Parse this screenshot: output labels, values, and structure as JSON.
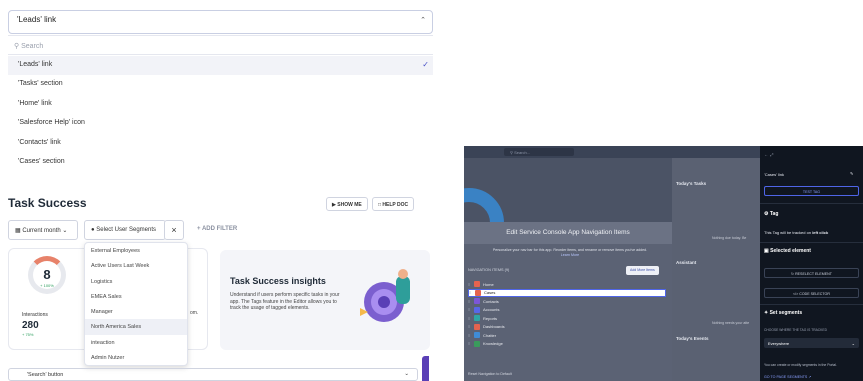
{
  "dropdown": {
    "selected_value": "'Leads' link",
    "search_placeholder": "Search",
    "options": [
      {
        "label": "'Leads' link",
        "selected": true
      },
      {
        "label": "'Tasks' section",
        "selected": false
      },
      {
        "label": "'Home' link",
        "selected": false
      },
      {
        "label": "'Salesforce Help' icon",
        "selected": false
      },
      {
        "label": "'Contacts' link",
        "selected": false
      },
      {
        "label": "'Cases' section",
        "selected": false
      }
    ]
  },
  "task_success": {
    "title": "Task Success",
    "show_me_label": "SHOW ME",
    "help_doc_label": "HELP DOC",
    "date_filter": "Current month",
    "segment_filter": "Select User Segments",
    "add_filter_label": "+ ADD FILTER",
    "gauge_value": "8",
    "gauge_change": "+ 100%",
    "interactions_label": "Interactions",
    "interactions_value": "280",
    "interactions_change": "+ 75%",
    "truncated_text": "om.",
    "insights_title": "Task Success insights",
    "insights_text": "Understand if users perform specific tasks in your app. The Tags feature in the Editor allows you to track the usage of tagged elements.",
    "segments_menu": [
      "External Employees",
      "Active Users Last Week",
      "Logistics",
      "EMEA Sales",
      "Manager",
      "North America Sales",
      "inteaction",
      "Admin Nutzer"
    ],
    "bottom_select": "'Search' button"
  },
  "salesforce": {
    "search_placeholder": "Search...",
    "todays_tasks": "Today's Tasks",
    "nothing_due": "Nothing due today. Be",
    "assistant": "Assistant",
    "nothing_needs": "Nothing needs your atte",
    "todays_events": "Today's Events",
    "modal_title": "Edit Service Console App Navigation Items",
    "modal_desc": "Personalize your nav bar for this app. Reorder items, and rename or remove items you've added.",
    "learn_more": "Learn More",
    "nav_items_label": "NAVIGATION ITEMS (9)",
    "add_more_label": "Add More Items",
    "nav_items": [
      {
        "label": "Home",
        "color": "#e5634f"
      },
      {
        "label": "Cases",
        "color": "#e5634f"
      },
      {
        "label": "Contacts",
        "color": "#7c56d8"
      },
      {
        "label": "Accounts",
        "color": "#5867e8"
      },
      {
        "label": "Reports",
        "color": "#2ea6a6"
      },
      {
        "label": "Dashboards",
        "color": "#e5634f"
      },
      {
        "label": "Chatter",
        "color": "#3f8cd6"
      },
      {
        "label": "Knowledge",
        "color": "#3a9b5c"
      }
    ],
    "reset_label": "Reset Navigation to Default"
  },
  "tag_panel": {
    "tag_name": "'Cases' link",
    "test_tag_label": "TEST TAG",
    "tag_header": "Tag",
    "tracked_text_prefix": "This Tag will be tracked on",
    "tracked_text_bold": "left click",
    "selected_element_header": "Selected element",
    "reselect_label": "RESELECT ELEMENT",
    "code_selector_label": "</> CODE SELECTOR",
    "set_segments_header": "Set segments",
    "choose_label": "CHOOSE WHERE THE TAG IS TRACKED",
    "where_value": "Everywhere",
    "segments_hint": "You can create or modify segments in the Portal.",
    "page_segments_link": "GO TO PAGE SEGMENTS"
  }
}
